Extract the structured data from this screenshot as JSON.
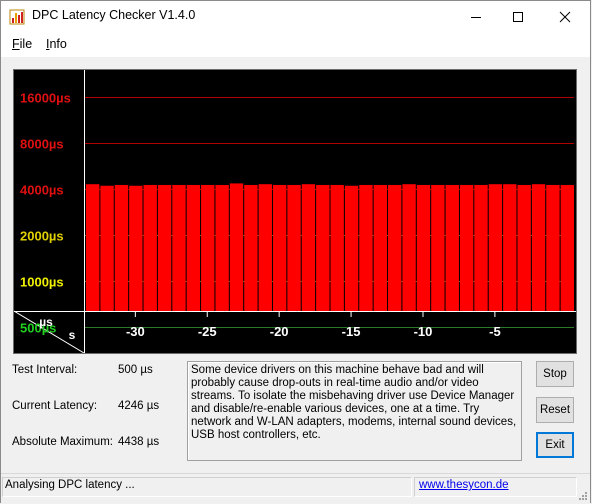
{
  "window": {
    "title": "DPC Latency Checker V1.4.0",
    "minimize_icon": "minimize-icon",
    "maximize_icon": "maximize-icon",
    "close_icon": "close-icon"
  },
  "menu": {
    "items": [
      {
        "label": "File",
        "mnemonic": "F"
      },
      {
        "label": "Info",
        "mnemonic": "I"
      }
    ]
  },
  "chart_data": {
    "type": "bar",
    "title": "",
    "ylabel": "µs",
    "xlabel": "s",
    "y_scale": "log",
    "y_ticks": [
      {
        "label": "16000µs",
        "value": 16000,
        "color": "#e01010"
      },
      {
        "label": "8000µs",
        "value": 8000,
        "color": "#e01010"
      },
      {
        "label": "4000µs",
        "value": 4000,
        "color": "#e01010"
      },
      {
        "label": "2000µs",
        "value": 2000,
        "color": "#e0d000"
      },
      {
        "label": "1000µs",
        "value": 1000,
        "color": "#f0f000"
      },
      {
        "label": "500µs",
        "value": 500,
        "color": "#20d020"
      }
    ],
    "x_ticks": [
      -30,
      -25,
      -20,
      -15,
      -10,
      -5
    ],
    "x_range": [
      -33,
      0
    ],
    "bar_color": "#ff0000",
    "bars": [
      {
        "x": -33,
        "value": 4300
      },
      {
        "x": -32,
        "value": 4200
      },
      {
        "x": -31,
        "value": 4250
      },
      {
        "x": -30,
        "value": 4200
      },
      {
        "x": -29,
        "value": 4250
      },
      {
        "x": -28,
        "value": 4250
      },
      {
        "x": -27,
        "value": 4250
      },
      {
        "x": -26,
        "value": 4250
      },
      {
        "x": -25,
        "value": 4250
      },
      {
        "x": -24,
        "value": 4250
      },
      {
        "x": -23,
        "value": 4350
      },
      {
        "x": -22,
        "value": 4250
      },
      {
        "x": -21,
        "value": 4300
      },
      {
        "x": -20,
        "value": 4250
      },
      {
        "x": -19,
        "value": 4250
      },
      {
        "x": -18,
        "value": 4300
      },
      {
        "x": -17,
        "value": 4250
      },
      {
        "x": -16,
        "value": 4250
      },
      {
        "x": -15,
        "value": 4200
      },
      {
        "x": -14,
        "value": 4250
      },
      {
        "x": -13,
        "value": 4250
      },
      {
        "x": -12,
        "value": 4250
      },
      {
        "x": -11,
        "value": 4300
      },
      {
        "x": -10,
        "value": 4250
      },
      {
        "x": -9,
        "value": 4250
      },
      {
        "x": -8,
        "value": 4250
      },
      {
        "x": -7,
        "value": 4250
      },
      {
        "x": -6,
        "value": 4250
      },
      {
        "x": -5,
        "value": 4300
      },
      {
        "x": -4,
        "value": 4300
      },
      {
        "x": -3,
        "value": 4250
      },
      {
        "x": -2,
        "value": 4300
      },
      {
        "x": -1,
        "value": 4250
      },
      {
        "x": 0,
        "value": 4246
      }
    ],
    "gridlines": true,
    "background": "#000000"
  },
  "stats": {
    "test_interval": {
      "label": "Test Interval:",
      "value": "500 µs"
    },
    "current_latency": {
      "label": "Current Latency:",
      "value": "4246 µs"
    },
    "absolute_maximum": {
      "label": "Absolute Maximum:",
      "value": "4438 µs"
    }
  },
  "message": "Some device drivers on this machine behave bad and will probably cause drop-outs in real-time audio and/or video streams. To isolate the misbehaving driver use Device Manager and disable/re-enable various devices, one at a time. Try network and W-LAN adapters, modems, internal sound devices, USB host controllers, etc.",
  "buttons": {
    "stop": "Stop",
    "reset": "Reset",
    "exit": "Exit"
  },
  "status": {
    "text": "Analysing DPC latency ...",
    "link": "www.thesycon.de"
  }
}
